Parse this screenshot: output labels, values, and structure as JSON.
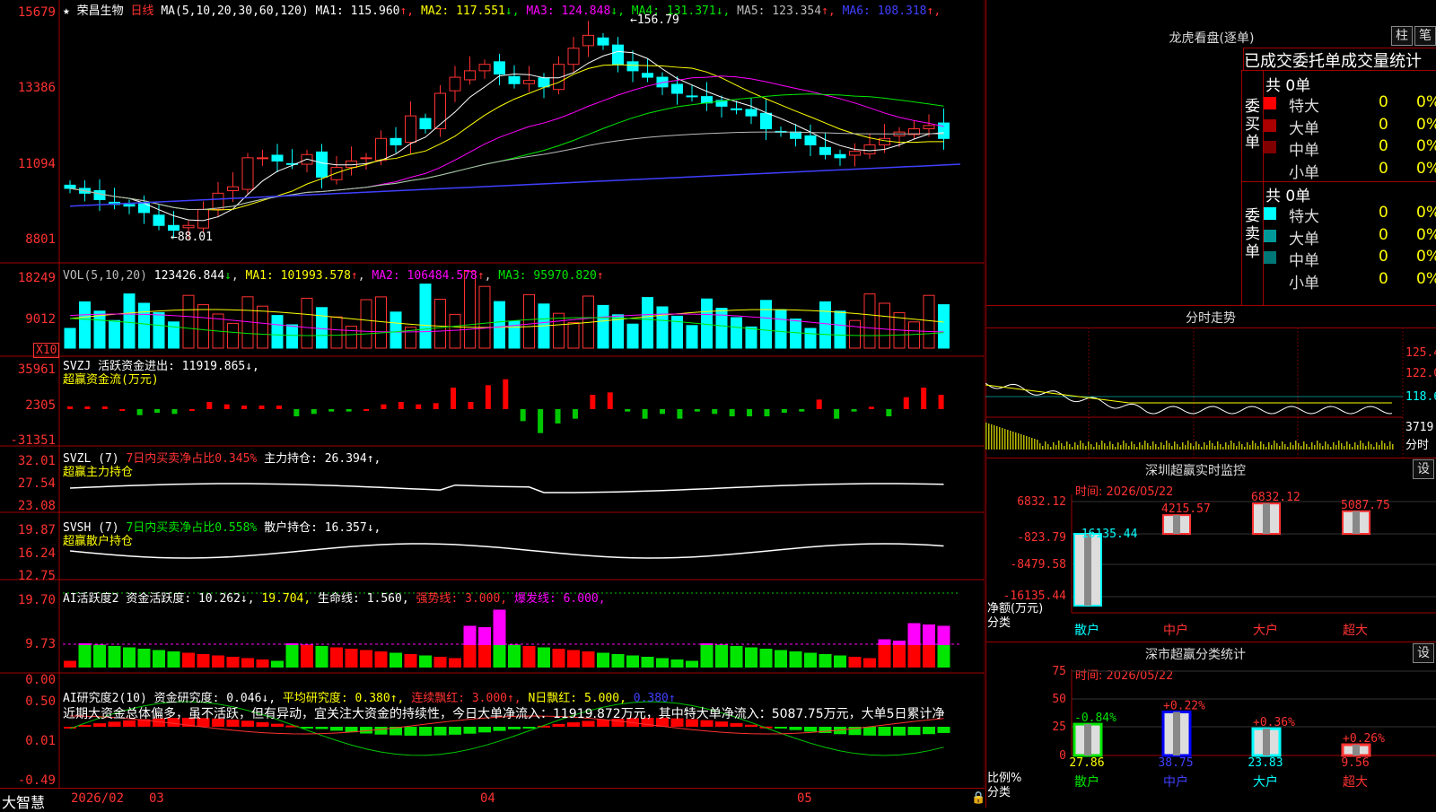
{
  "header": {
    "star": "★",
    "stock_name": "荣昌生物",
    "period": "日线",
    "ma_params": "MA(5,10,20,30,60,120)",
    "ma": [
      {
        "label": "MA1: 115.960",
        "arrow": "↑",
        "color": "#ffffff"
      },
      {
        "label": "MA2: 117.551",
        "arrow": "↓",
        "color": "#ffff00"
      },
      {
        "label": "MA3: 124.848",
        "arrow": "↓",
        "color": "#ff00ff"
      },
      {
        "label": "MA4: 131.371",
        "arrow": "↓",
        "color": "#00e600"
      },
      {
        "label": "MA5: 123.354",
        "arrow": "↑",
        "color": "#bbbbbb"
      },
      {
        "label": "MA6: 108.318",
        "arrow": "↑",
        "color": "#4040ff"
      }
    ]
  },
  "price_axis": [
    "15679",
    "13386",
    "11094",
    "8801"
  ],
  "price_annotations": {
    "high": "156.79",
    "low": "88.01"
  },
  "vol_pane": {
    "axis": [
      "18249",
      "9012"
    ],
    "unit_badge": "X10",
    "label": "VOL(5,10,20)",
    "value": "123426.844",
    "value_arrow": "↓",
    "ma1": "MA1: 101993.578",
    "ma1_arrow": "↑",
    "ma2": "MA2: 106484.578",
    "ma2_arrow": "↑",
    "ma3": "MA3: 95970.820",
    "ma3_arrow": "↑"
  },
  "svzj_pane": {
    "axis": [
      "35961",
      "2305",
      "-31351"
    ],
    "label": "SVZJ  活跃资金进出: 11919.865↓,",
    "sub": "超赢资金流(万元)"
  },
  "svzl_pane": {
    "axis": [
      "32.01",
      "27.54",
      "23.08"
    ],
    "label_a": "SVZL (7)",
    "label_b": "7日内买卖净占比0.345%",
    "label_c": "主力持仓: 26.394↑,",
    "sub": "超赢主力持仓"
  },
  "svsh_pane": {
    "axis": [
      "19.87",
      "16.24",
      "12.75"
    ],
    "label_a": "SVSH (7)",
    "label_b": "7日内买卖净占比0.558%",
    "label_c": "散户持仓: 16.357↓,",
    "sub": "超赢散户持仓"
  },
  "ai_active_pane": {
    "axis": [
      "19.70",
      "9.73",
      "0.00"
    ],
    "label_a": "AI活跃度2",
    "label_b": "资金活跃度: 10.262↓,",
    "label_c": "19.704,",
    "label_d": "生命线: 1.560,",
    "label_e": "强势线: 3.000,",
    "label_f": "爆发线: 6.000,"
  },
  "ai_research_pane": {
    "axis": [
      "0.50",
      "0.01",
      "-0.49"
    ],
    "label_a": "AI研究度2(10)",
    "label_b": "资金研究度: 0.046↓,",
    "label_c": "平均研究度: 0.380↑,",
    "label_d": "连续飘红: 3.000↑,",
    "label_e": "N日飘红: 5.000,",
    "label_f": "0.380↑",
    "commentary": "近期大资金总体偏多，虽不活跃，但有异动，宜关注大资金的持续性，今日大单净流入：11919.872万元，其中特大单净流入：5087.75万元，大单5日累计净"
  },
  "date_axis": {
    "brand": "大智慧",
    "labels": [
      "2026/02",
      "03",
      "04",
      "05"
    ]
  },
  "right_panel": {
    "dragon_title": "龙虎看盘(逐单)",
    "btn_column": "柱",
    "btn_stroke": "笔",
    "tabs_text": "已成交委托单成交量统计",
    "buy_side": {
      "vlabel": "委买单",
      "total": "共 0单",
      "rows": [
        {
          "name": "特大",
          "n1": "0",
          "n2": "0%",
          "color": "#ff0000"
        },
        {
          "name": "大单",
          "n1": "0",
          "n2": "0%",
          "color": "#aa0000"
        },
        {
          "name": "中单",
          "n1": "0",
          "n2": "0%",
          "color": "#800000"
        },
        {
          "name": "小单",
          "n1": "0",
          "n2": "0%",
          "color": "#000000"
        }
      ]
    },
    "sell_side": {
      "vlabel": "委卖单",
      "total": "共 0单",
      "rows": [
        {
          "name": "特大",
          "n1": "0",
          "n2": "0%",
          "color": "#00ffff"
        },
        {
          "name": "大单",
          "n1": "0",
          "n2": "0%",
          "color": "#009999"
        },
        {
          "name": "中单",
          "n1": "0",
          "n2": "0%",
          "color": "#007777"
        },
        {
          "name": "小单",
          "n1": "0",
          "n2": "0%",
          "color": "#000000"
        }
      ]
    },
    "intraday": {
      "title": "分时走势",
      "axis": [
        "125.4",
        "122.0",
        "118.6"
      ],
      "vol_max": "3719",
      "unit": "分时"
    },
    "sz_monitor": {
      "title": "深圳超赢实时监控",
      "btn": "设",
      "time": "时间: 2026/05/22",
      "axis": [
        "6832.12",
        "-823.79",
        "-8479.58",
        "-16135.44"
      ],
      "unit_a": "净额(万元)",
      "unit_b": "分类",
      "cats": [
        "散户",
        "中户",
        "大户",
        "超大"
      ],
      "values": [
        "-16135.44",
        "4215.57",
        "6832.12",
        "5087.75"
      ]
    },
    "sz_class": {
      "title": "深市超赢分类统计",
      "btn": "设",
      "time": "时间: 2026/05/22",
      "axis": [
        "75",
        "50",
        "25",
        "0"
      ],
      "unit_a": "比例%",
      "unit_b": "分类",
      "cats": [
        "散户",
        "中户",
        "大户",
        "超大"
      ],
      "values": [
        "27.86",
        "38.75",
        "23.83",
        "9.56"
      ],
      "changes": [
        "-0.84%",
        "+0.22%",
        "+0.36%",
        "+0.26%"
      ]
    }
  },
  "chart_data": [
    {
      "type": "candlestick",
      "title": "荣昌生物 日线",
      "ylim": [
        88.01,
        156.79
      ],
      "x": [
        "2026/02",
        "03",
        "04",
        "05"
      ],
      "close_approx": [
        102.5,
        101,
        99,
        97.5,
        97,
        95,
        91,
        89.5,
        91,
        96,
        101,
        103,
        112,
        112,
        111,
        110,
        113,
        106,
        109,
        111,
        112,
        118,
        116,
        125,
        121,
        132,
        137,
        139,
        141,
        138,
        135,
        136,
        134,
        141,
        146,
        150,
        147,
        141,
        139,
        137,
        134,
        132,
        131,
        129,
        128,
        127,
        125,
        121,
        120,
        118,
        116,
        113,
        112,
        114,
        116,
        118,
        120,
        121,
        122,
        118
      ]
    },
    {
      "type": "bar",
      "title": "超赢资金流(万元)",
      "ylim": [
        -31351,
        35961
      ],
      "values_approx": [
        2305,
        2305,
        2305,
        0,
        -5000,
        -3000,
        -4000,
        0,
        6000,
        4000,
        3000,
        3000,
        3000,
        -6000,
        -4000,
        -2000,
        -2000,
        0,
        4000,
        6000,
        4000,
        5000,
        18000,
        6000,
        20000,
        25000,
        -10000,
        -20000,
        -12000,
        -8000,
        12000,
        14000,
        -2000,
        -8000,
        -4000,
        -8000,
        -2000,
        -4000,
        -6000,
        -6000,
        -6000,
        -3000,
        -2000,
        8000,
        -8000,
        -2000,
        2000,
        -6000,
        10000,
        18000,
        11919
      ]
    },
    {
      "type": "bar",
      "title": "深圳超赢实时监控",
      "categories": [
        "散户",
        "中户",
        "大户",
        "超大"
      ],
      "values": [
        -16135.44,
        4215.57,
        6832.12,
        5087.75
      ],
      "ylim": [
        -16135.44,
        6832.12
      ]
    },
    {
      "type": "bar",
      "title": "深市超赢分类统计",
      "categories": [
        "散户",
        "中户",
        "大户",
        "超大"
      ],
      "values": [
        27.86,
        38.75,
        23.83,
        9.56
      ],
      "ylim": [
        0,
        75
      ]
    }
  ]
}
